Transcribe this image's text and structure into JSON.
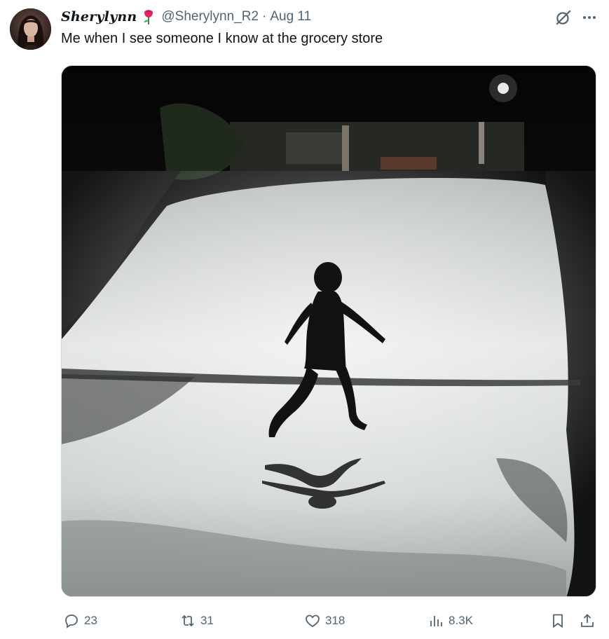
{
  "tweet": {
    "display_name": "Sherylynn",
    "name_emoji": "rose-icon",
    "handle": "@Sherylynn_R2",
    "separator": "·",
    "date": "Aug 11",
    "text": "Me when I see someone I know at the grocery store"
  },
  "header_icons": [
    "grok-icon",
    "more-icon"
  ],
  "media": {
    "type": "photo",
    "icon": "photo"
  },
  "actions": {
    "reply_count": "23",
    "repost_count": "31",
    "like_count": "318",
    "view_count": "8.3K"
  },
  "colors": {
    "text_primary": "#0f1419",
    "text_secondary": "#536471",
    "border": "#cfd9de"
  }
}
